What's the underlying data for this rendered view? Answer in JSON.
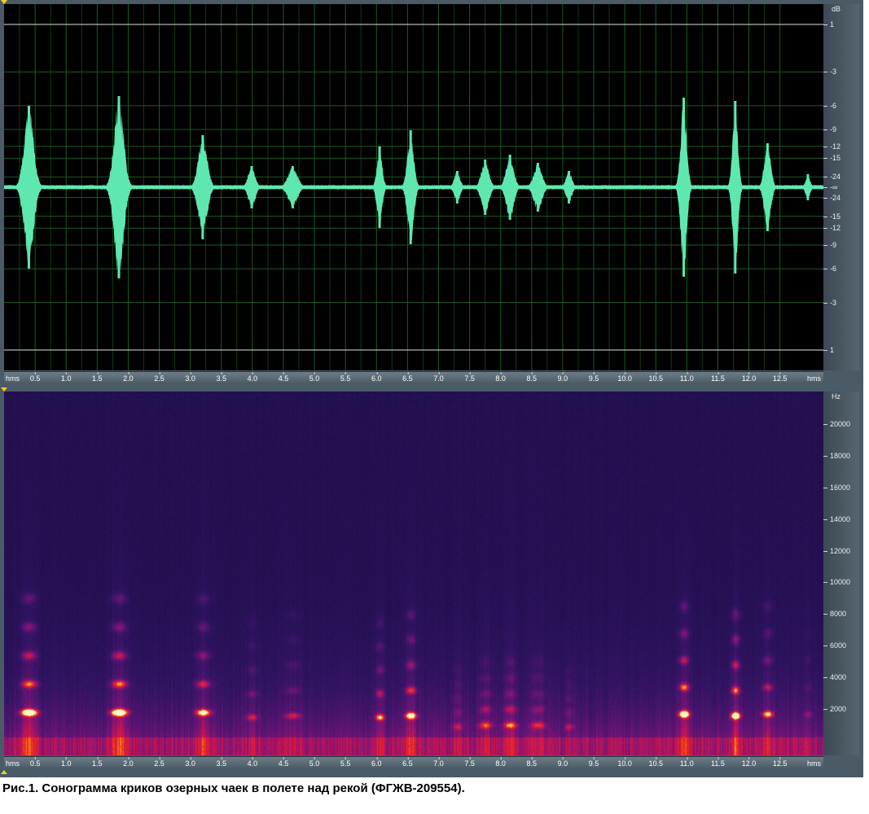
{
  "caption": "Рис.1. Сонограмма криков озерных чаек в полете над рекой (ФГЖВ-209554).",
  "waveform": {
    "unit_label": "dB",
    "scale_labels": [
      "1",
      "-3",
      "-6",
      "-9",
      "-12",
      "-15",
      "-24",
      "-∞",
      "-24",
      "-15",
      "-12",
      "-9",
      "-6",
      "-3",
      "1"
    ],
    "scale_levels": [
      1.0,
      0.708,
      0.501,
      0.355,
      0.251,
      0.178,
      0.063,
      0.0,
      -0.063,
      -0.178,
      -0.251,
      -0.355,
      -0.501,
      -0.708,
      -1.0
    ],
    "color": "#5ee8b0"
  },
  "spectrogram": {
    "unit_label": "Hz",
    "freq_ticks": [
      "20000",
      "18000",
      "16000",
      "14000",
      "12000",
      "10000",
      "8000",
      "6000",
      "4000",
      "2000"
    ],
    "freq_values": [
      20000,
      18000,
      16000,
      14000,
      12000,
      10000,
      8000,
      6000,
      4000,
      2000
    ],
    "max_freq": 22050
  },
  "time_ruler": {
    "unit_label": "hms",
    "ticks": [
      "0.5",
      "1.0",
      "1.5",
      "2.0",
      "2.5",
      "3.0",
      "3.5",
      "4.0",
      "4.5",
      "5.0",
      "5.5",
      "6.0",
      "6.5",
      "7.0",
      "7.5",
      "8.0",
      "8.5",
      "9.0",
      "9.5",
      "10.0",
      "10.5",
      "11.0",
      "11.5",
      "12.0",
      "12.5"
    ],
    "tick_values": [
      0.5,
      1.0,
      1.5,
      2.0,
      2.5,
      3.0,
      3.5,
      4.0,
      4.5,
      5.0,
      5.5,
      6.0,
      6.5,
      7.0,
      7.5,
      8.0,
      8.5,
      9.0,
      9.5,
      10.0,
      10.5,
      11.0,
      11.5,
      12.0,
      12.5
    ]
  },
  "chart_data": {
    "type": "area",
    "xlabel": "hms",
    "ylabel": "dB",
    "x_range": [
      0,
      13.2
    ],
    "grid": true,
    "series": [
      {
        "calls_time_s": [
          0.4,
          1.85,
          3.2,
          3.99,
          4.65,
          6.05,
          6.55,
          7.3,
          7.75,
          8.15,
          8.6,
          9.1,
          10.95,
          11.78,
          12.3,
          12.95
        ],
        "calls_peak_amplitude": [
          0.5,
          0.56,
          0.32,
          0.13,
          0.13,
          0.25,
          0.35,
          0.1,
          0.17,
          0.2,
          0.15,
          0.1,
          0.55,
          0.53,
          0.27,
          0.08
        ],
        "calls_dominant_freq_hz": [
          1800,
          1800,
          1800,
          1500,
          1600,
          1500,
          1600,
          900,
          1000,
          1000,
          1000,
          900,
          1700,
          1600,
          1700,
          1700
        ]
      }
    ]
  }
}
